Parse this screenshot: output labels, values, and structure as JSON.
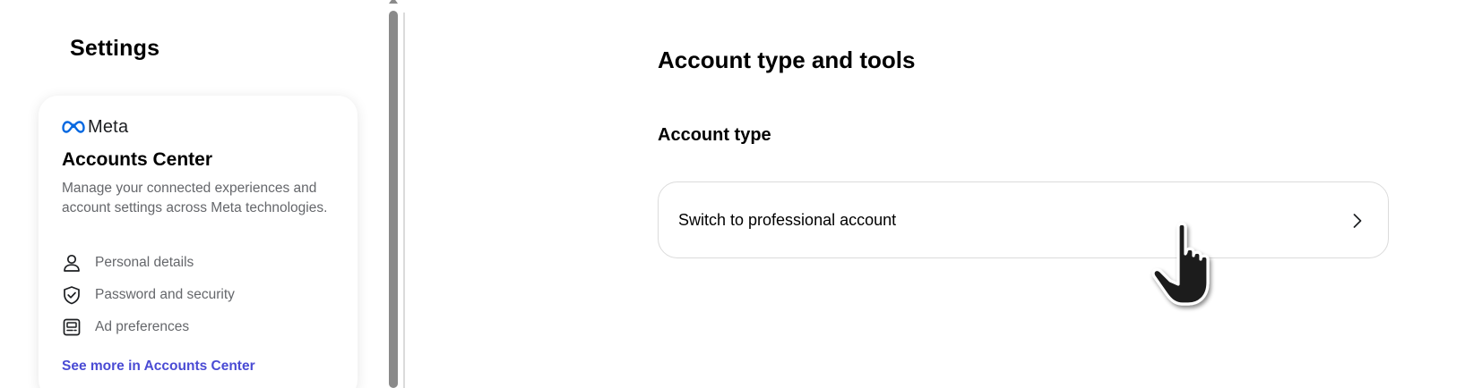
{
  "sidebar": {
    "title": "Settings",
    "accounts_center": {
      "logo_text": "Meta",
      "logo_icon": "meta-infinity-icon",
      "title": "Accounts Center",
      "description": "Manage your connected experiences and account settings across Meta technologies.",
      "items": [
        {
          "label": "Personal details",
          "icon": "person-icon"
        },
        {
          "label": "Password and security",
          "icon": "shield-check-icon"
        },
        {
          "label": "Ad preferences",
          "icon": "ad-preferences-icon"
        }
      ],
      "see_more_label": "See more in Accounts Center"
    }
  },
  "main": {
    "title": "Account type and tools",
    "section_title": "Account type",
    "switch_row": {
      "label": "Switch to professional account",
      "icon": "chevron-right-icon"
    }
  },
  "colors": {
    "link": "#4a4bd4",
    "secondary_text": "#65676b",
    "border": "#dbdbdb",
    "meta_blue": "#0668e1"
  }
}
